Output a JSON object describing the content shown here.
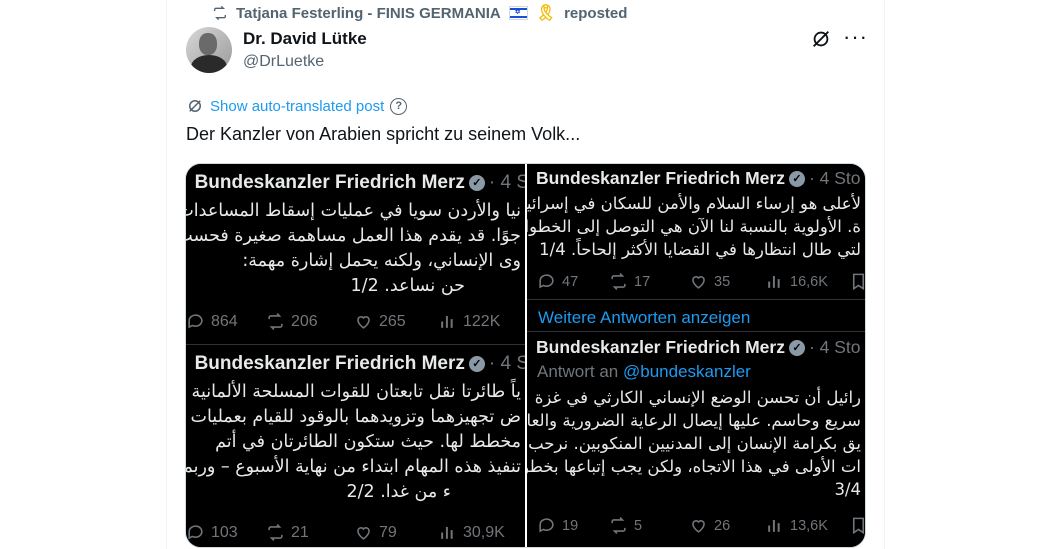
{
  "repost": {
    "user": "Tatjana Festerling - FINIS GERMANIA",
    "label": "reposted"
  },
  "author": {
    "name": "Dr. David Lütke",
    "handle": "@DrLuetke"
  },
  "translate": {
    "label": "Show auto-translated post"
  },
  "post": {
    "text": "Der Kanzler von Arabien spricht zu seinem Volk..."
  },
  "media": {
    "top_left": {
      "name": "Bundeskanzler Friedrich Merz",
      "meta": "· 4 S",
      "lines": [
        "نيا والأردن سويا في عمليات إسقاط المساعدات",
        "جوًا. قد يقدم هذا العمل مساهمة صغيرة فحسب",
        "وى الإنساني، ولكنه يحمل إشارة مهمة:",
        "حن نساعد. 1/2"
      ],
      "replies": "864",
      "reposts": "206",
      "likes": "265",
      "views": "122K"
    },
    "bottom_left": {
      "name": "Bundeskanzler Friedrich Merz",
      "meta": "· 4 S",
      "lines": [
        "ياً طائرتا نقل تابعتان للقوات المسلحة الألمانية إلى",
        "ض تجهيزهما وتزويدهما بالوقود للقيام بعمليات",
        "مخطط لها. حيث ستكون الطائرتان في أتم",
        "تنفيذ هذه المهام ابتداء من نهاية الأسبوع – وربما",
        "ء من غدا. 2/2"
      ],
      "replies": "103",
      "reposts": "21",
      "likes": "79",
      "views": "30,9K"
    },
    "right_top": {
      "name": "Bundeskanzler Friedrich Merz",
      "meta": "· 4 Sto",
      "lines": [
        "لأعلى هو إرساء السلام والأمن للسكان في إسرائيل",
        "ة. الأولوية بالنسبة لنا الآن هي التوصل إلى الخطوات",
        "لتي طال انتظارها في القضايا الأكثر إلحاحاً. 1/4"
      ],
      "replies": "47",
      "reposts": "17",
      "likes": "35",
      "views": "16,6K"
    },
    "show_more": "Weitere Antworten anzeigen",
    "right_bottom": {
      "name": "Bundeskanzler Friedrich Merz",
      "meta": "· 4 Sto",
      "reply_prefix": "Antwort an",
      "reply_handle": "@bundeskanzler",
      "lines": [
        "رائيل أن تحسن الوضع الإنساني الكارثي في غزة",
        "سريع وحاسم. عليها إيصال الرعاية الضرورية والعاجلة",
        "يق بكرامة الإنسان إلى المدنيين المنكوبين. نرحب",
        "ات الأولى في هذا الاتجاه، ولكن يجب إتباعها بخطوات",
        "3/4"
      ],
      "replies": "19",
      "reposts": "5",
      "likes": "26",
      "views": "13,6K"
    }
  },
  "colors": {
    "accent": "#1d9bf0",
    "muted": "#536471",
    "dark_bg": "#000000",
    "dark_text": "#e7e9ea",
    "dark_muted": "#71767b"
  }
}
